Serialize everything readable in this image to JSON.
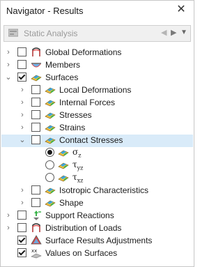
{
  "window": {
    "title": "Navigator - Results"
  },
  "analysis_dropdown": {
    "value": "Static Analysis"
  },
  "tree": {
    "global_deformations": "Global Deformations",
    "members": "Members",
    "surfaces": "Surfaces",
    "local_deformations": "Local Deformations",
    "internal_forces": "Internal Forces",
    "stresses": "Stresses",
    "strains": "Strains",
    "contact_stresses": "Contact Stresses",
    "sigma_z": {
      "base": "σ",
      "sub": "z"
    },
    "tau_yz": {
      "base": "τ",
      "sub": "yz"
    },
    "tau_xz": {
      "base": "τ",
      "sub": "xz"
    },
    "isotropic_characteristics": "Isotropic Characteristics",
    "shape": "Shape",
    "support_reactions": "Support Reactions",
    "distribution_of_loads": "Distribution of Loads",
    "surface_results_adjustments": "Surface Results Adjustments",
    "values_on_surfaces": "Values on Surfaces"
  },
  "colors": {
    "selection": "#d9ebf9",
    "checkbox_border": "#5a5a5a",
    "dropdown_bg": "#f0f0f0"
  }
}
